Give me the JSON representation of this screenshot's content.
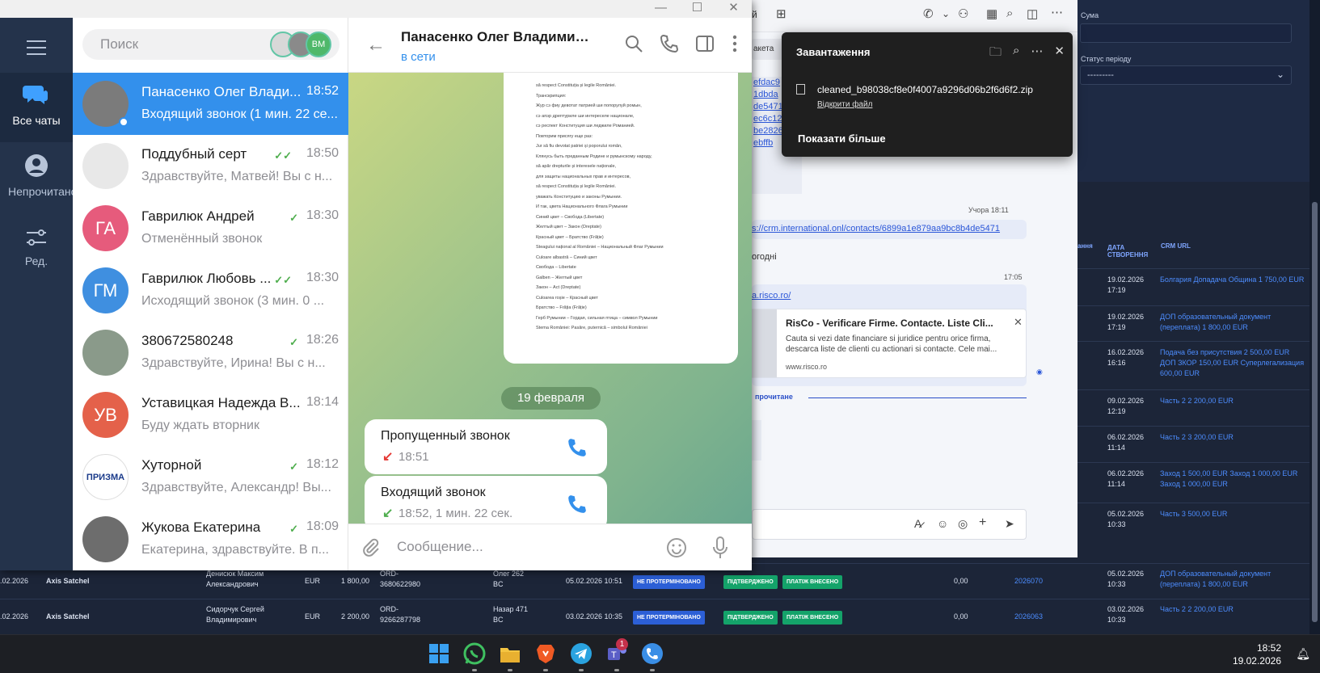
{
  "telegram": {
    "search_placeholder": "Поиск",
    "rail": {
      "all_chats": "Все чаты",
      "unread": "Непрочитано",
      "edit": "Ред."
    },
    "search_avatar_initials": "ВМ",
    "chats": [
      {
        "name": "Панасенко Олег Влади...",
        "time": "18:52",
        "preview": "Входящий звонок (1 мин. 22 се...",
        "initials": "",
        "color": "#7b7b7b"
      },
      {
        "name": "Поддубный серт",
        "time": "18:50",
        "preview": "Здравствуйте, Матвей!  Вы с н...",
        "initials": "",
        "color": "#e8e8e8",
        "check": "✓✓"
      },
      {
        "name": "Гаврилюк Андрей",
        "time": "18:30",
        "preview": "Отменённый звонок",
        "initials": "ГА",
        "color": "#e65b7c",
        "check": "✓"
      },
      {
        "name": "Гаврилюк Любовь ...",
        "time": "18:30",
        "preview": "Исходящий звонок (3 мин. 0 ...",
        "initials": "ГМ",
        "color": "#3f8fe0",
        "check": "✓✓"
      },
      {
        "name": "380672580248",
        "time": "18:26",
        "preview": "Здравствуйте, Ирина!  Вы с н...",
        "initials": "",
        "color": "#8a9a8a",
        "check": "✓"
      },
      {
        "name": "Уставицкая Надежда В...",
        "time": "18:14",
        "preview": "Буду ждать вторник",
        "initials": "УВ",
        "color": "#e4614a"
      },
      {
        "name": "Хуторной",
        "time": "18:12",
        "preview": "Здравствуйте, Александр!  Вы...",
        "initials": "ПРИЗМА",
        "color": "#ffffff",
        "check": "✓"
      },
      {
        "name": "Жукова Екатерина",
        "time": "18:09",
        "preview": "Екатерина, здравствуйте. В п...",
        "initials": "",
        "color": "#6d6d6d",
        "check": "✓"
      }
    ],
    "conversation": {
      "title": "Панасенко Олег Владимир...",
      "status": "в сети",
      "date_separator": "19 февраля",
      "calls": [
        {
          "title": "Пропущенный звонок",
          "meta": "18:51",
          "arrow": "↙",
          "arrow_color": "#e53935"
        },
        {
          "title": "Входящий звонок",
          "meta": "18:52, 1 мин. 22 сек.",
          "arrow": "↙",
          "arrow_color": "#4fae4e"
        }
      ],
      "compose_placeholder": "Сообщение...",
      "document_lines": [
        "să respect Constituția și legile României.",
        "Транскрипция:",
        "Жур сэ фиу девотат патрией ши попорулуй ромын,",
        "сэ апэр дрептуриле ши интереселе национале,",
        "сэ респект Конституция ши леджиле Романией.",
        "Повторим присягу еще раз:",
        "Jur să fiu devotat patriei și poporului român,",
        "Клянусь быть преданным Родине и румынскому народу,",
        "să apăr drepturile și interesele naționale,",
        "для защиты национальных прав и интересов,",
        "să respect Constituția și legile României.",
        "уважать Конституцию и законы Румынии.",
        "И так, цвета Национального Флага Румынии",
        "Синий цвет – Свобода (Libertate)",
        "Желтый цвет – Закон (Dreptate)",
        "Красный цвет – Братство (Frăție)",
        "Steagului național al României – Национальный Флаг Румынии",
        "Culoare albastră – Синий цвет",
        "Свобода – Libertate",
        "Galben – Желтый цвет",
        "Закон – Act (Dreptate)",
        "Culoarea roșie – Красный цвет",
        "Братство – Frăția (Frăție)",
        "Герб Румынии – Гордая, сильная птица – символ Румынии",
        "Stema României: Pasăre, puternică – simbolul României"
      ]
    }
  },
  "downloads": {
    "title": "Завантаження",
    "file": "cleaned_b98038cf8e0f4007a9296d06b2f6d6f2.zip",
    "open_file": "Відкрити файл",
    "show_more": "Показати більше"
  },
  "window2": {
    "chip": "акета",
    "hashes": [
      "efdac9",
      "1dbda",
      "de5471",
      "ec6c12",
      "be2826",
      "ebffb"
    ],
    "time_yesterday": "Учора 18:11",
    "crm_link": "s://crm.international.onl/contacts/6899a1e879aa9bc8b4de5471",
    "agree_text": "огодні",
    "time_today": "17:05",
    "risco_link": "a.risco.ro/",
    "preview_title": "RisCo - Verificare Firme. Contacte. Liste Cli...",
    "preview_desc": "Cauta si vezi date financiare si juridice pentru orice firma, descarca liste de clienti cu actionari si contacte. Cele mai...",
    "preview_domain": "www.risco.ro",
    "unread_label": "прочитане",
    "title_partial": "й"
  },
  "crm": {
    "field_sum": "Сума",
    "field_period_status": "Статус періоду",
    "period_value": "---------",
    "col_headers": [
      "ання",
      "ДАТА СТВОРЕННЯ",
      "CRM URL"
    ],
    "rows": [
      {
        "date": "19.02.2026 17:19",
        "url": "Болгария Допадача Община 1 750,00 EUR"
      },
      {
        "date": "19.02.2026 17:19",
        "url": "ДОП образовательный документ (переплата) 1 800,00 EUR"
      },
      {
        "date": "16.02.2026 16:16",
        "url": "Подача без присутствия 2 500,00 EUR ДОП ЗКОР 150,00 EUR Суперлегализация 600,00 EUR"
      },
      {
        "date": "09.02.2026 12:19",
        "url": "Часть 2 2 200,00 EUR"
      },
      {
        "date": "06.02.2026 11:14",
        "url": "Часть 2 3 200,00 EUR"
      },
      {
        "date": "06.02.2026 11:14",
        "url": "Заход 1 500,00 EUR Заход 1 000,00 EUR Заход 1 000,00 EUR"
      },
      {
        "date": "05.02.2026 10:33",
        "url": "Часть 3 500,00 EUR"
      }
    ],
    "bottom_rows": [
      {
        "date_left": ".02.2026",
        "product": "Axis Satchel",
        "client": "Денисюк Максим Александрович",
        "cur": "EUR",
        "amount": "1 800,00",
        "ord": "ORD-3680622980",
        "manager": "Олег 262 BC",
        "created": "05.02.2026 10:51",
        "s1": "НЕ ПРОТЕРМІНОВАНО",
        "s2": "ПІДТВЕРДЖЕНО",
        "s3": "ПЛАТІЖ ВНЕСЕНО",
        "zero": "0,00",
        "num": "2026070",
        "date_r": "05.02.2026 10:33",
        "url": "ДОП образовательный документ (переплата) 1 800,00 EUR"
      },
      {
        "date_left": ".02.2026",
        "product": "Axis Satchel",
        "client": "Сидорчук Сергей Владимирович",
        "cur": "EUR",
        "amount": "2 200,00",
        "ord": "ORD-9266287798",
        "manager": "Назар 471 BC",
        "created": "03.02.2026 10:35",
        "s1": "НЕ ПРОТЕРМІНОВАНО",
        "s2": "ПІДТВЕРДЖЕНО",
        "s3": "ПЛАТІЖ ВНЕСЕНО",
        "zero": "0,00",
        "num": "2026063",
        "date_r": "03.02.2026 10:33",
        "url": "Часть 2 2 200,00 EUR"
      }
    ]
  },
  "taskbar": {
    "time": "18:52",
    "date": "19.02.2026",
    "teams_badge": "1"
  }
}
